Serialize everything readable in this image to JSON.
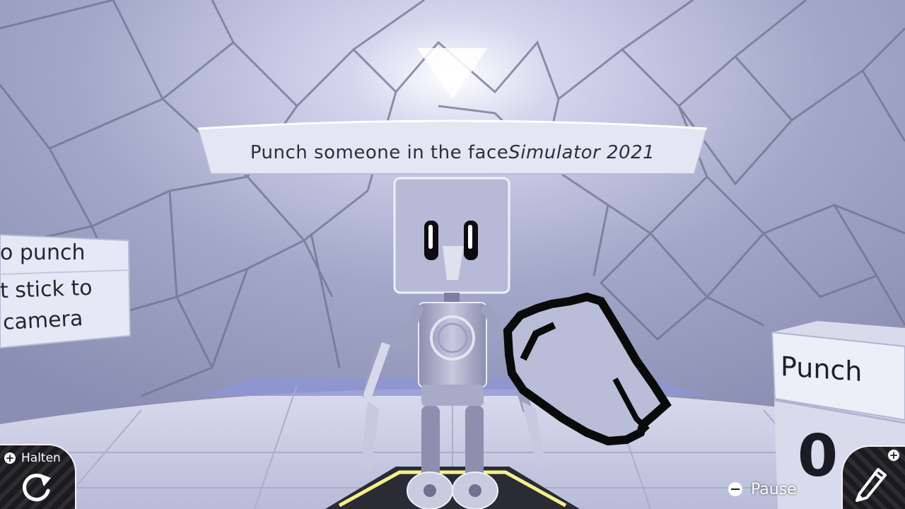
{
  "banner": {
    "title_main": "Punch someone in the face ",
    "title_italic": "Simulator 2021"
  },
  "left_sign": {
    "line1": "o punch",
    "line2": "t stick to",
    "line3": "camera"
  },
  "punch_box": {
    "label": "Punch",
    "count": "0"
  },
  "hud": {
    "hold_label": "Halten",
    "hold_badge": "+",
    "hold_icon": "rotate-icon",
    "pause_label": "Pause",
    "pause_icon": "minus-icon",
    "edit_badge": "+",
    "edit_icon": "pencil-icon"
  },
  "colors": {
    "wall": "#9ea2c4",
    "floor": "#c9cbe2",
    "hud_dark": "#1b1b1f",
    "accent_yellow": "#f5f08a"
  }
}
